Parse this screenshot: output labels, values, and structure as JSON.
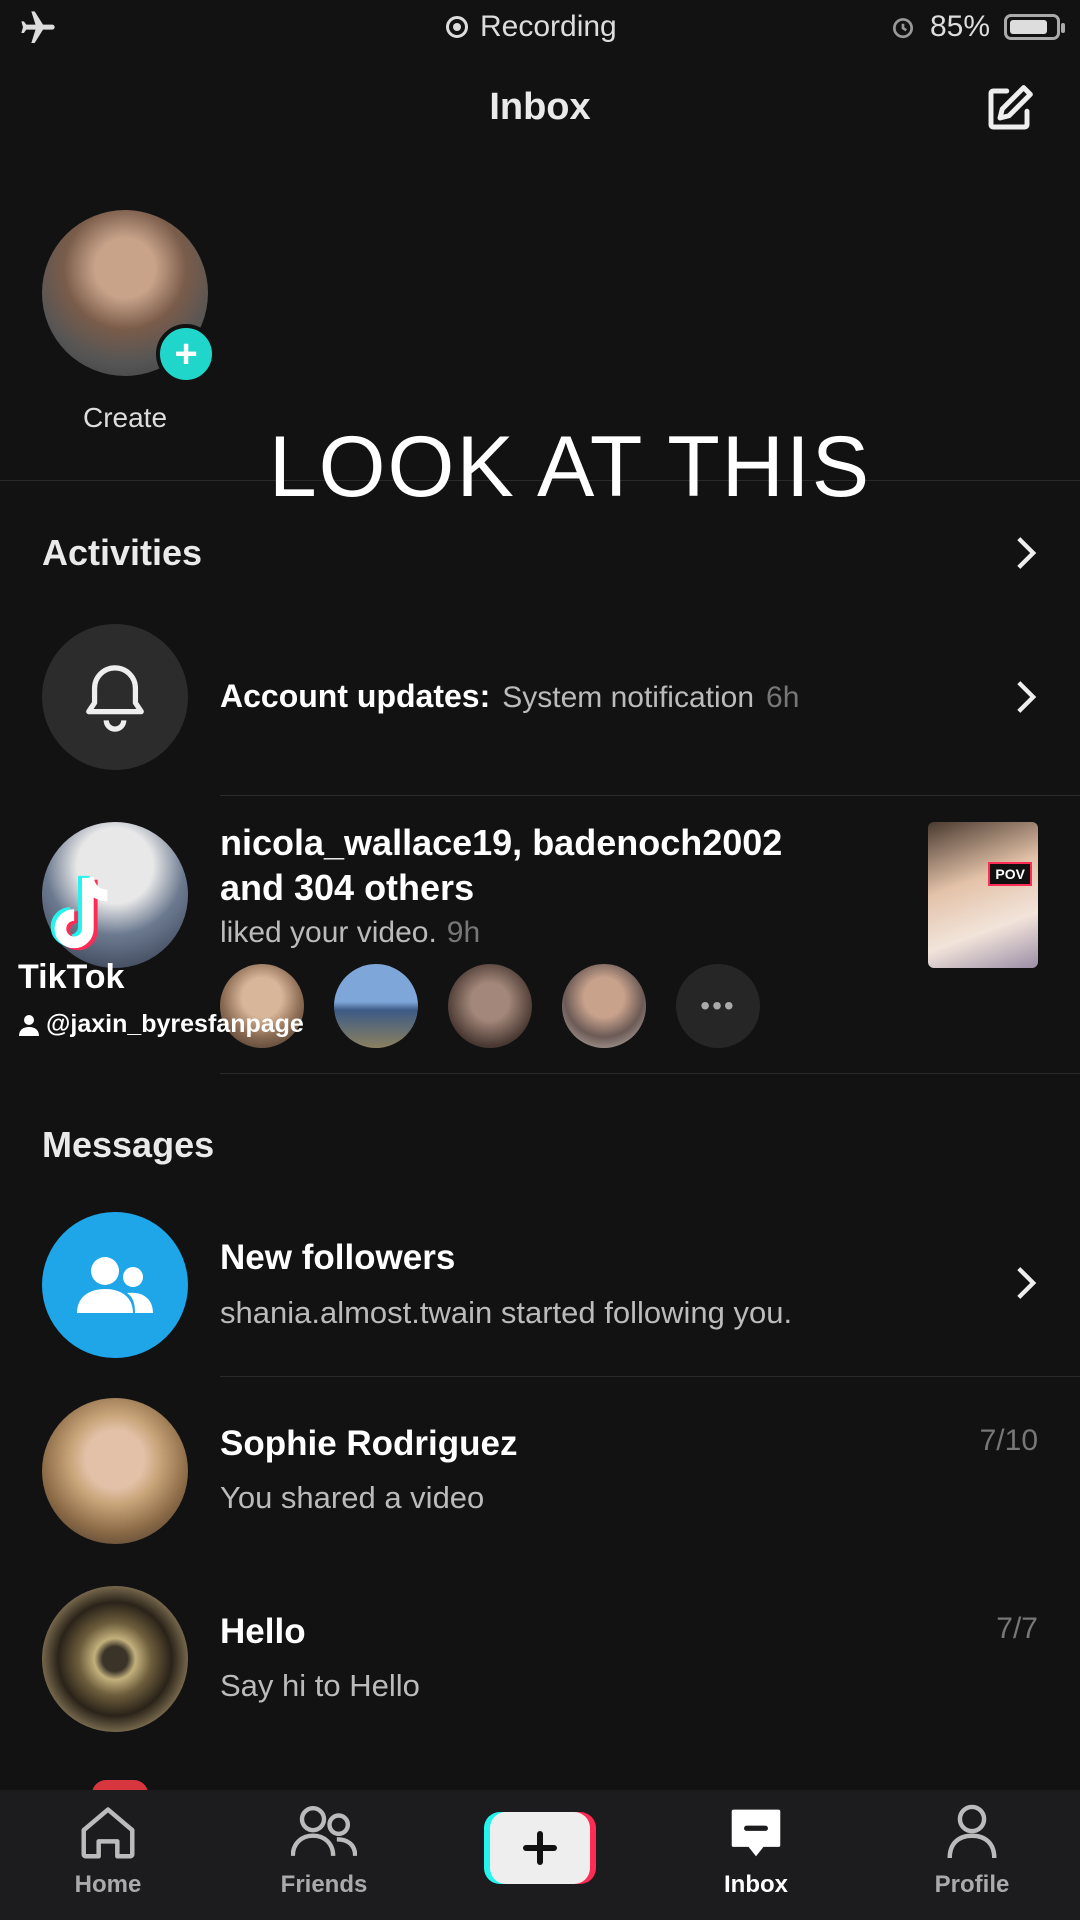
{
  "status_bar": {
    "recording": "Recording",
    "battery": "85%",
    "battery_level": 0.85
  },
  "header": {
    "title": "Inbox"
  },
  "create": {
    "label": "Create"
  },
  "overlay": {
    "caption": "LOOK AT THIS"
  },
  "activities": {
    "heading": "Activities",
    "account_updates": {
      "label": "Account updates:",
      "text": "System notification",
      "time": "6h"
    },
    "likes": {
      "names_line1": "nicola_wallace19, badenoch2002",
      "names_line2": "and 304 others",
      "text": "liked your video.",
      "time": "9h",
      "thumb_badge": "POV"
    }
  },
  "watermark": {
    "brand": "TikTok",
    "handle": "@jaxin_byresfanpage"
  },
  "messages": {
    "heading": "Messages",
    "items": [
      {
        "name": "New followers",
        "preview": "shania.almost.twain started following you.",
        "time": ""
      },
      {
        "name": "Sophie Rodriguez",
        "preview": "You shared a video",
        "time": "7/10"
      },
      {
        "name": "Hello",
        "preview": "Say hi to Hello",
        "time": "7/7"
      }
    ]
  },
  "tabbar": {
    "home": "Home",
    "friends": "Friends",
    "inbox": "Inbox",
    "profile": "Profile"
  },
  "colors": {
    "background": "#121212",
    "accent_teal": "#20d5c9",
    "followers_blue": "#1ea6e8"
  }
}
